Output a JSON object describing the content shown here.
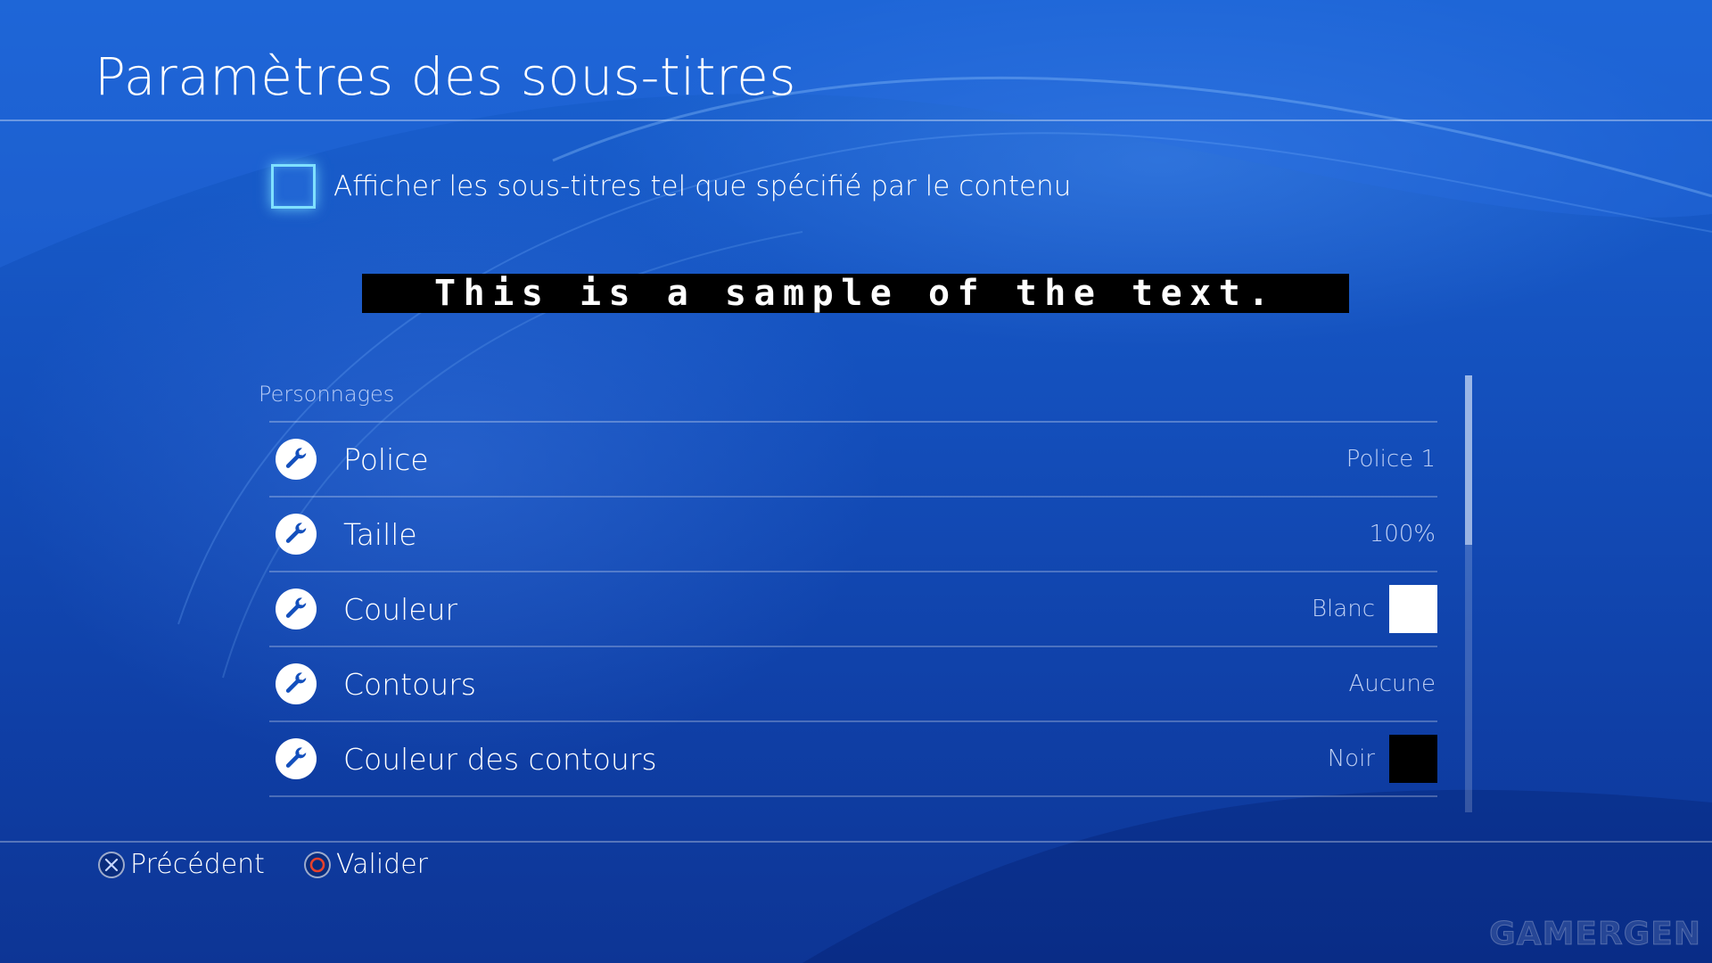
{
  "header": {
    "title": "Paramètres des sous-titres"
  },
  "content_option": {
    "label": "Afficher les sous-titres tel que spécifié par le contenu",
    "checked": false
  },
  "preview": {
    "sample_text": "This is a sample of the text."
  },
  "section": {
    "label": "Personnages"
  },
  "settings": [
    {
      "label": "Police",
      "value": "Police 1",
      "icon": "wrench-icon"
    },
    {
      "label": "Taille",
      "value": "100%",
      "icon": "wrench-icon"
    },
    {
      "label": "Couleur",
      "value": "Blanc",
      "icon": "wrench-icon",
      "swatch": "#ffffff"
    },
    {
      "label": "Contours",
      "value": "Aucune",
      "icon": "wrench-icon"
    },
    {
      "label": "Couleur des contours",
      "value": "Noir",
      "icon": "wrench-icon",
      "swatch": "#000000"
    }
  ],
  "scrollbar": {
    "position_fraction": 0.0
  },
  "footer": {
    "back_label": "Précédent",
    "back_icon": "cross-button-icon",
    "confirm_label": "Valider",
    "confirm_icon": "circle-button-icon"
  },
  "watermark": "GAMERGEN",
  "colors": {
    "background": "#1450bd",
    "highlight": "#7fe0ff",
    "circle_button": "#e8412b"
  }
}
